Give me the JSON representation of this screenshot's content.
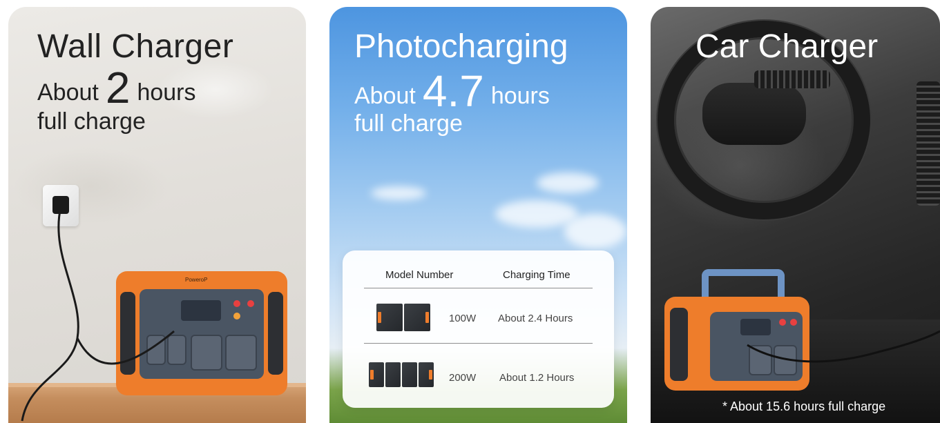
{
  "cards": {
    "wall": {
      "title": "Wall Charger",
      "prefix": "About",
      "hours": "2",
      "suffix": "hours",
      "line2": "full charge"
    },
    "solar": {
      "title": "Photocharging",
      "prefix": "About",
      "hours": "4.7",
      "suffix": "hours",
      "line2": "full charge"
    },
    "car": {
      "title": "Car Charger",
      "note": "* About 15.6 hours full charge"
    }
  },
  "table": {
    "headers": {
      "model": "Model Number",
      "time": "Charging Time"
    },
    "rows": [
      {
        "model": "100W",
        "time": "About 2.4 Hours",
        "panel_icon": "solar-panel-2-fold-icon"
      },
      {
        "model": "200W",
        "time": "About 1.2 Hours",
        "panel_icon": "solar-panel-4-fold-icon"
      }
    ]
  },
  "colors": {
    "accent_orange": "#ee7d2b",
    "dark_text": "#222222",
    "white_text": "#ffffff"
  }
}
